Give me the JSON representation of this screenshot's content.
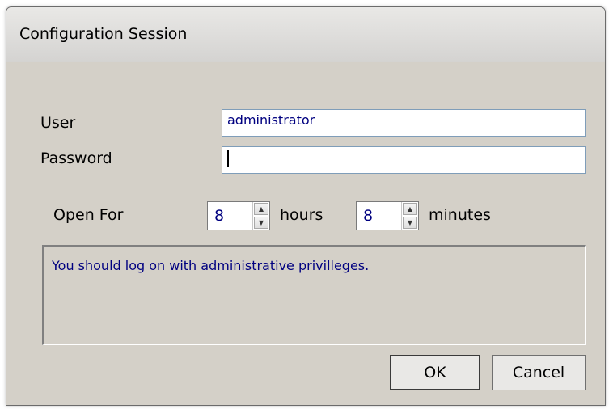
{
  "window": {
    "title": "Configuration Session"
  },
  "form": {
    "user_label": "User",
    "user_value": "administrator",
    "password_label": "Password",
    "password_value": "",
    "open_for_label": "Open For",
    "hours_value": "8",
    "hours_label": "hours",
    "minutes_value": "8",
    "minutes_label": "minutes",
    "message": "You should log on with administrative privilleges."
  },
  "buttons": {
    "ok": "OK",
    "cancel": "Cancel"
  },
  "icons": {
    "spin_up": "spin-up-arrow",
    "spin_down": "spin-down-arrow"
  }
}
